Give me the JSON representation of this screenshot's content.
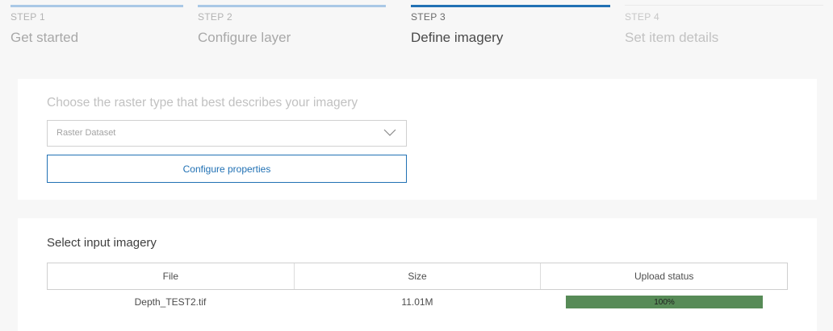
{
  "stepper": {
    "steps": [
      {
        "number": "STEP 1",
        "title": "Get started",
        "state": "complete"
      },
      {
        "number": "STEP 2",
        "title": "Configure layer",
        "state": "complete"
      },
      {
        "number": "STEP 3",
        "title": "Define imagery",
        "state": "active"
      },
      {
        "number": "STEP 4",
        "title": "Set item details",
        "state": "pending"
      }
    ]
  },
  "raster": {
    "label": "Choose the raster type that best describes your imagery",
    "select_value": "Raster Dataset",
    "configure_button": "Configure properties"
  },
  "imagery": {
    "title": "Select input imagery",
    "columns": [
      "File",
      "Size",
      "Upload status"
    ],
    "rows": [
      {
        "file": "Depth_TEST2.tif",
        "size": "11.01M",
        "upload_progress": 100,
        "upload_label": "100%"
      }
    ]
  },
  "colors": {
    "accent": "#2171b4",
    "progress_fill": "#578b57"
  }
}
